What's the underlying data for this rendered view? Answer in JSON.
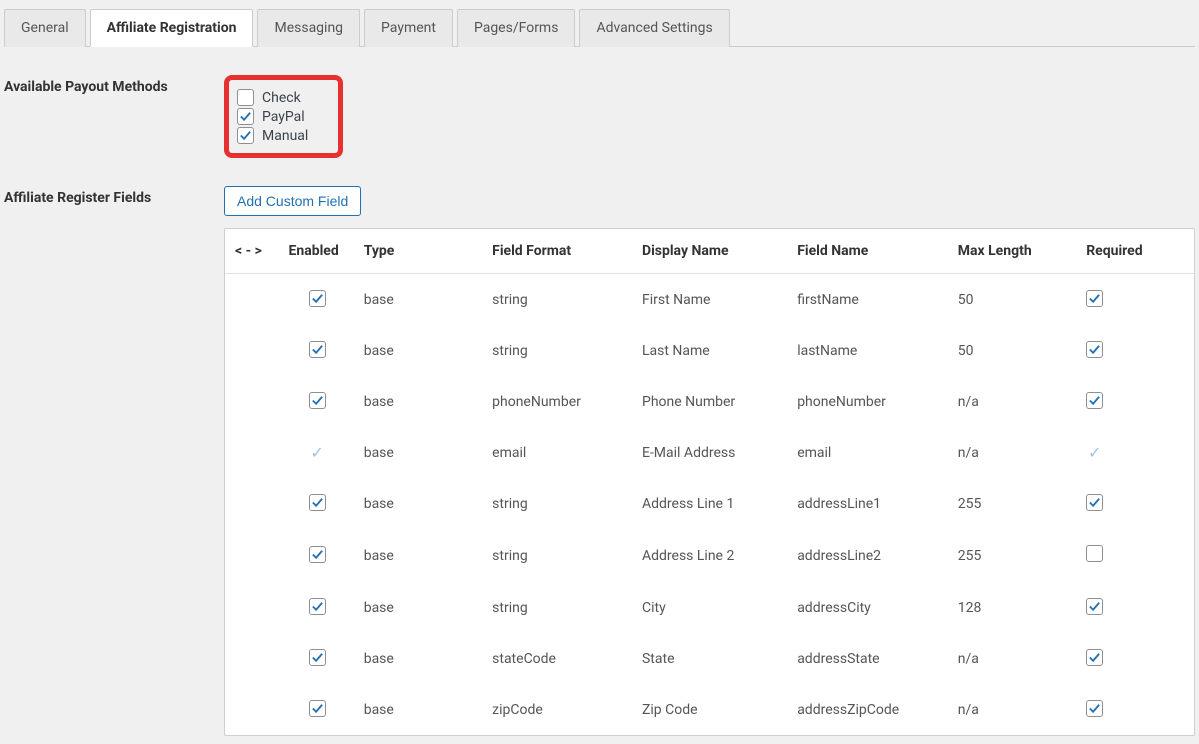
{
  "tabs": [
    {
      "label": "General"
    },
    {
      "label": "Affiliate Registration"
    },
    {
      "label": "Messaging"
    },
    {
      "label": "Payment"
    },
    {
      "label": "Pages/Forms"
    },
    {
      "label": "Advanced Settings"
    }
  ],
  "activeTab": 1,
  "payout": {
    "label": "Available Payout Methods",
    "options": [
      {
        "label": "Check",
        "checked": false
      },
      {
        "label": "PayPal",
        "checked": true
      },
      {
        "label": "Manual",
        "checked": true
      }
    ]
  },
  "registerFields": {
    "label": "Affiliate Register Fields",
    "addButton": "Add Custom Field",
    "headers": {
      "sort": "< - >",
      "enabled": "Enabled",
      "type": "Type",
      "fieldFormat": "Field Format",
      "displayName": "Display Name",
      "fieldName": "Field Name",
      "maxLength": "Max Length",
      "required": "Required"
    },
    "rows": [
      {
        "enabled": true,
        "locked": false,
        "type": "base",
        "format": "string",
        "display": "First Name",
        "field": "firstName",
        "maxlen": "50",
        "required": true,
        "requiredLocked": false
      },
      {
        "enabled": true,
        "locked": false,
        "type": "base",
        "format": "string",
        "display": "Last Name",
        "field": "lastName",
        "maxlen": "50",
        "required": true,
        "requiredLocked": false
      },
      {
        "enabled": true,
        "locked": false,
        "type": "base",
        "format": "phoneNumber",
        "display": "Phone Number",
        "field": "phoneNumber",
        "maxlen": "n/a",
        "required": true,
        "requiredLocked": false
      },
      {
        "enabled": true,
        "locked": true,
        "type": "base",
        "format": "email",
        "display": "E-Mail Address",
        "field": "email",
        "maxlen": "n/a",
        "required": true,
        "requiredLocked": true
      },
      {
        "enabled": true,
        "locked": false,
        "type": "base",
        "format": "string",
        "display": "Address Line 1",
        "field": "addressLine1",
        "maxlen": "255",
        "required": true,
        "requiredLocked": false
      },
      {
        "enabled": true,
        "locked": false,
        "type": "base",
        "format": "string",
        "display": "Address Line 2",
        "field": "addressLine2",
        "maxlen": "255",
        "required": false,
        "requiredLocked": false
      },
      {
        "enabled": true,
        "locked": false,
        "type": "base",
        "format": "string",
        "display": "City",
        "field": "addressCity",
        "maxlen": "128",
        "required": true,
        "requiredLocked": false
      },
      {
        "enabled": true,
        "locked": false,
        "type": "base",
        "format": "stateCode",
        "display": "State",
        "field": "addressState",
        "maxlen": "n/a",
        "required": true,
        "requiredLocked": false
      },
      {
        "enabled": true,
        "locked": false,
        "type": "base",
        "format": "zipCode",
        "display": "Zip Code",
        "field": "addressZipCode",
        "maxlen": "n/a",
        "required": true,
        "requiredLocked": false
      }
    ]
  }
}
